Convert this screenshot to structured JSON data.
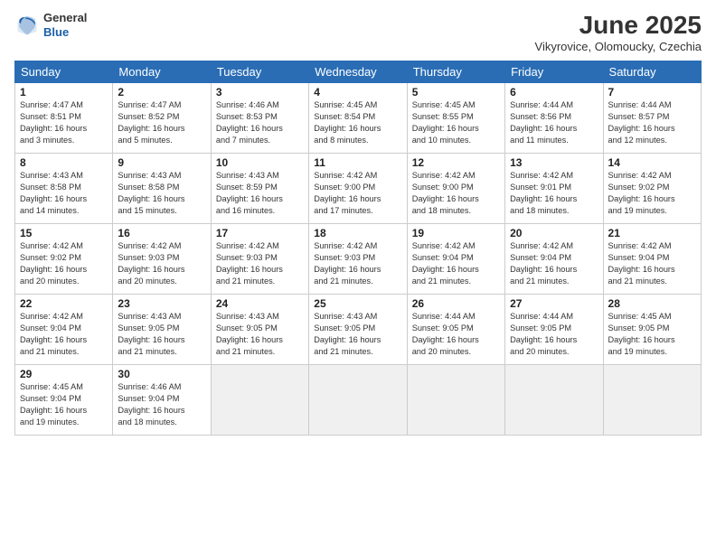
{
  "header": {
    "logo_general": "General",
    "logo_blue": "Blue",
    "month_title": "June 2025",
    "location": "Vikyrovice, Olomoucky, Czechia"
  },
  "weekdays": [
    "Sunday",
    "Monday",
    "Tuesday",
    "Wednesday",
    "Thursday",
    "Friday",
    "Saturday"
  ],
  "weeks": [
    [
      {
        "day": "1",
        "info": "Sunrise: 4:47 AM\nSunset: 8:51 PM\nDaylight: 16 hours\nand 3 minutes."
      },
      {
        "day": "2",
        "info": "Sunrise: 4:47 AM\nSunset: 8:52 PM\nDaylight: 16 hours\nand 5 minutes."
      },
      {
        "day": "3",
        "info": "Sunrise: 4:46 AM\nSunset: 8:53 PM\nDaylight: 16 hours\nand 7 minutes."
      },
      {
        "day": "4",
        "info": "Sunrise: 4:45 AM\nSunset: 8:54 PM\nDaylight: 16 hours\nand 8 minutes."
      },
      {
        "day": "5",
        "info": "Sunrise: 4:45 AM\nSunset: 8:55 PM\nDaylight: 16 hours\nand 10 minutes."
      },
      {
        "day": "6",
        "info": "Sunrise: 4:44 AM\nSunset: 8:56 PM\nDaylight: 16 hours\nand 11 minutes."
      },
      {
        "day": "7",
        "info": "Sunrise: 4:44 AM\nSunset: 8:57 PM\nDaylight: 16 hours\nand 12 minutes."
      }
    ],
    [
      {
        "day": "8",
        "info": "Sunrise: 4:43 AM\nSunset: 8:58 PM\nDaylight: 16 hours\nand 14 minutes."
      },
      {
        "day": "9",
        "info": "Sunrise: 4:43 AM\nSunset: 8:58 PM\nDaylight: 16 hours\nand 15 minutes."
      },
      {
        "day": "10",
        "info": "Sunrise: 4:43 AM\nSunset: 8:59 PM\nDaylight: 16 hours\nand 16 minutes."
      },
      {
        "day": "11",
        "info": "Sunrise: 4:42 AM\nSunset: 9:00 PM\nDaylight: 16 hours\nand 17 minutes."
      },
      {
        "day": "12",
        "info": "Sunrise: 4:42 AM\nSunset: 9:00 PM\nDaylight: 16 hours\nand 18 minutes."
      },
      {
        "day": "13",
        "info": "Sunrise: 4:42 AM\nSunset: 9:01 PM\nDaylight: 16 hours\nand 18 minutes."
      },
      {
        "day": "14",
        "info": "Sunrise: 4:42 AM\nSunset: 9:02 PM\nDaylight: 16 hours\nand 19 minutes."
      }
    ],
    [
      {
        "day": "15",
        "info": "Sunrise: 4:42 AM\nSunset: 9:02 PM\nDaylight: 16 hours\nand 20 minutes."
      },
      {
        "day": "16",
        "info": "Sunrise: 4:42 AM\nSunset: 9:03 PM\nDaylight: 16 hours\nand 20 minutes."
      },
      {
        "day": "17",
        "info": "Sunrise: 4:42 AM\nSunset: 9:03 PM\nDaylight: 16 hours\nand 21 minutes."
      },
      {
        "day": "18",
        "info": "Sunrise: 4:42 AM\nSunset: 9:03 PM\nDaylight: 16 hours\nand 21 minutes."
      },
      {
        "day": "19",
        "info": "Sunrise: 4:42 AM\nSunset: 9:04 PM\nDaylight: 16 hours\nand 21 minutes."
      },
      {
        "day": "20",
        "info": "Sunrise: 4:42 AM\nSunset: 9:04 PM\nDaylight: 16 hours\nand 21 minutes."
      },
      {
        "day": "21",
        "info": "Sunrise: 4:42 AM\nSunset: 9:04 PM\nDaylight: 16 hours\nand 21 minutes."
      }
    ],
    [
      {
        "day": "22",
        "info": "Sunrise: 4:42 AM\nSunset: 9:04 PM\nDaylight: 16 hours\nand 21 minutes."
      },
      {
        "day": "23",
        "info": "Sunrise: 4:43 AM\nSunset: 9:05 PM\nDaylight: 16 hours\nand 21 minutes."
      },
      {
        "day": "24",
        "info": "Sunrise: 4:43 AM\nSunset: 9:05 PM\nDaylight: 16 hours\nand 21 minutes."
      },
      {
        "day": "25",
        "info": "Sunrise: 4:43 AM\nSunset: 9:05 PM\nDaylight: 16 hours\nand 21 minutes."
      },
      {
        "day": "26",
        "info": "Sunrise: 4:44 AM\nSunset: 9:05 PM\nDaylight: 16 hours\nand 20 minutes."
      },
      {
        "day": "27",
        "info": "Sunrise: 4:44 AM\nSunset: 9:05 PM\nDaylight: 16 hours\nand 20 minutes."
      },
      {
        "day": "28",
        "info": "Sunrise: 4:45 AM\nSunset: 9:05 PM\nDaylight: 16 hours\nand 19 minutes."
      }
    ],
    [
      {
        "day": "29",
        "info": "Sunrise: 4:45 AM\nSunset: 9:04 PM\nDaylight: 16 hours\nand 19 minutes."
      },
      {
        "day": "30",
        "info": "Sunrise: 4:46 AM\nSunset: 9:04 PM\nDaylight: 16 hours\nand 18 minutes."
      },
      {
        "day": "",
        "info": ""
      },
      {
        "day": "",
        "info": ""
      },
      {
        "day": "",
        "info": ""
      },
      {
        "day": "",
        "info": ""
      },
      {
        "day": "",
        "info": ""
      }
    ]
  ]
}
